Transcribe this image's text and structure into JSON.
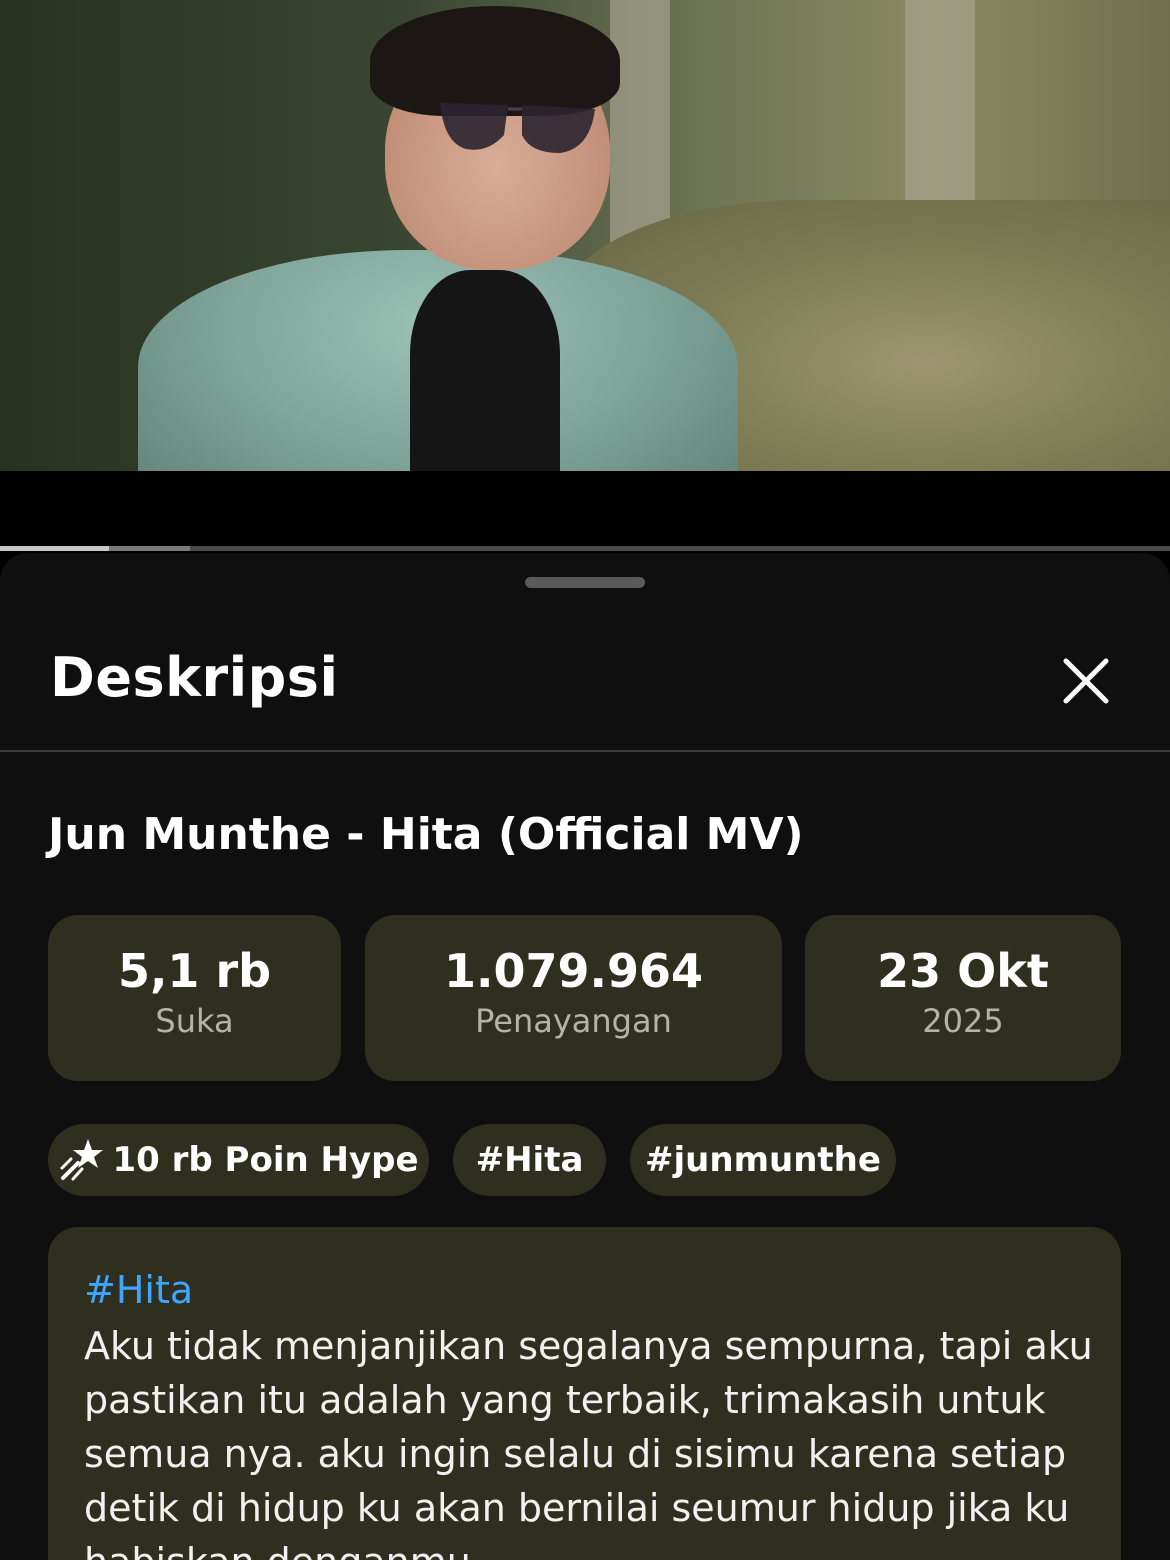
{
  "sheet": {
    "title": "Deskripsi",
    "close_icon": "close-icon"
  },
  "video": {
    "title": "Jun Munthe - Hita (Official MV)",
    "progress_played": 0.093,
    "progress_buffered": 0.162
  },
  "stats": [
    {
      "value": "5,1 rb",
      "label": "Suka"
    },
    {
      "value": "1.079.964",
      "label": "Penayangan"
    },
    {
      "value": "23 Okt",
      "label": "2025"
    }
  ],
  "chips": [
    {
      "label": "10 rb Poin Hype",
      "icon": "hype-star-icon"
    },
    {
      "label": "#Hita"
    },
    {
      "label": "#junmunthe"
    }
  ],
  "description": {
    "hashtag": "#Hita",
    "text": "Aku tidak menjanjikan segalanya sempurna, tapi aku pastikan itu adalah yang terbaik, trimakasih untuk semua nya. aku ingin selalu di sisimu karena setiap detik di hidup ku akan bernilai seumur hidup jika ku habiskan denganmu"
  },
  "colors": {
    "sheet_bg": "#0f0f0f",
    "card_bg": "#2f2f1f",
    "hashtag": "#3ea6ff"
  }
}
